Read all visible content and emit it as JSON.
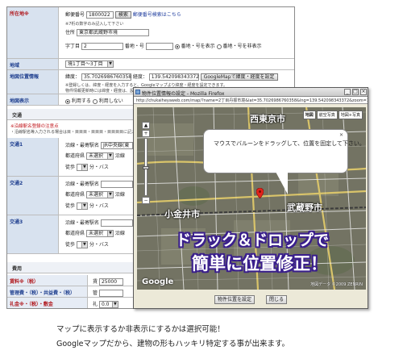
{
  "form": {
    "location": {
      "label": "所在地※",
      "postal_label": "郵便番号",
      "postal_value": "1800022",
      "search_button": "検索",
      "postal_search_link": "郵便番号検索はこちら",
      "note": "※7桁の数字のみ記入して下さい",
      "address_label": "住所",
      "address_value": "東京都武蔵野市境",
      "chome_label": "字丁目",
      "chome_value": "2",
      "banchi_label": "番地・号",
      "opt_show": "番地・号を表示",
      "opt_hide": "番地・号を非表示"
    },
    "area": {
      "label": "地域",
      "value": "境1丁目〜3丁目"
    },
    "geo": {
      "label": "地図位置情報",
      "lat_label": "緯度：",
      "lat_value": "35.7026986760358",
      "lng_label": "経度：",
      "lng_value": "139.542098343372",
      "button": "GoogleMapで緯度・経度を設定",
      "note1": "※登録しくは、緯度・経度を入力すると、Googleマップより緯度・経度を設定できます。",
      "note2": "物件情報更新時には緯度・経度は、設定変更されません。物件名・住所の同し場所に一括でセットされます。"
    },
    "mapdisplay": {
      "label": "地図表示",
      "opt_use": "利用する",
      "opt_nouse": "利用しない"
    },
    "traffic": {
      "heading": "交通",
      "warn": "※沿線駅名登録の注意点",
      "warn_note": "・沿線駅名等入力される場合は目・目目目・目目目・目目目目に記入して下さい",
      "rows": [
        {
          "label": "交通1",
          "line_label": "沿線・最寄駅名",
          "line_value": "JR中央線(東",
          "pref_label": "都道府県",
          "pref_value": "未選択",
          "line2_label": "沿線",
          "walk": "徒歩",
          "min": "分・バス"
        },
        {
          "label": "交通2",
          "line_label": "沿線・最寄駅名",
          "line_value": "",
          "pref_label": "都道府県",
          "pref_value": "未選択",
          "line2_label": "沿線",
          "walk": "徒歩",
          "min": "分・バス"
        },
        {
          "label": "交通3",
          "line_label": "沿線・最寄駅名",
          "line_value": "",
          "pref_label": "都道府県",
          "pref_value": "未選択",
          "line2_label": "沿線",
          "walk": "徒歩",
          "min": "分・バス"
        }
      ]
    },
    "cost": {
      "heading": "費用",
      "rent_label": "賃料※（税）",
      "rent_prefix": "賃",
      "rent_value": "25000",
      "mgmt_label": "管理費・（税）・共益費・（税）",
      "mgmt_prefix": "管",
      "key_label": "礼金※・（税）・敷金",
      "key_prefix": "礼",
      "key_value": "0.0"
    }
  },
  "popup": {
    "title": "物件位置情報の設定 - Mozilla Firefox",
    "address_bar": "http://chukaiheyaweb.com/map/?name=2丁目丹振市境&lat=35.7026986760358&lng=139.542098343372&zoom=13&acb=",
    "tabs": [
      "地図",
      "航空写真",
      "地図+写真"
    ],
    "callout_text": "マウスでバルーンをドラッグして、位置を固定して下さい。",
    "labels": {
      "nishitokyo": "西東京市",
      "musashino": "武蔵野市",
      "koganei": "小金井市"
    },
    "banner_line1": "ドラック＆ドロップで",
    "banner_line2": "簡単に位置修正！",
    "google_logo": "Google",
    "copyright": "地図データ ©2009 ZENRIN",
    "btn_set": "物件位置を設定",
    "btn_close": "閉じる"
  },
  "caption": {
    "line1": "マップに表示するか非表示にするかは選択可能！",
    "line2": "Googleマップだから、建物の形もハッキリ特定する事が出来ます。"
  }
}
